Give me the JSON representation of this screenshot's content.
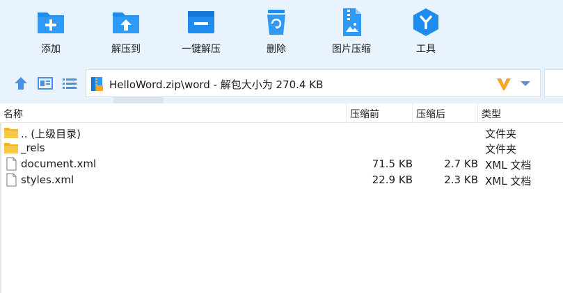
{
  "toolbar": {
    "items": [
      {
        "label": "添加",
        "icon": "add-icon"
      },
      {
        "label": "解压到",
        "icon": "extract-to-icon"
      },
      {
        "label": "一键解压",
        "icon": "quick-extract-icon"
      },
      {
        "label": "删除",
        "icon": "delete-icon"
      },
      {
        "label": "图片压缩",
        "icon": "image-compress-icon"
      },
      {
        "label": "工具",
        "icon": "tools-icon"
      }
    ]
  },
  "nav": {
    "path": "HelloWord.zip\\word - 解包大小为 270.4 KB"
  },
  "list": {
    "columns": [
      "名称",
      "压缩前",
      "压缩后",
      "类型"
    ],
    "rows": [
      {
        "name": ".. (上级目录)",
        "before": "",
        "after": "",
        "type": "文件夹",
        "icon": "folder-icon"
      },
      {
        "name": "_rels",
        "before": "",
        "after": "",
        "type": "文件夹",
        "icon": "folder-icon"
      },
      {
        "name": "document.xml",
        "before": "71.5 KB",
        "after": "2.7 KB",
        "type": "XML 文档",
        "icon": "file-icon"
      },
      {
        "name": "styles.xml",
        "before": "22.9 KB",
        "after": "2.3 KB",
        "type": "XML 文档",
        "icon": "file-icon"
      }
    ]
  },
  "colors": {
    "toolbar_bg": "#e9f3fd",
    "icon_blue": "#1e8cef",
    "accent_orange": "#f5a623"
  }
}
